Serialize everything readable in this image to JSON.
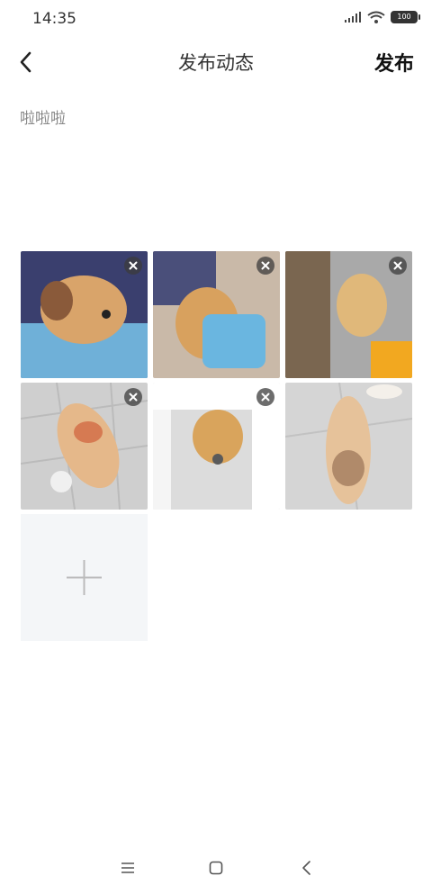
{
  "status": {
    "time": "14:35",
    "battery": "100"
  },
  "header": {
    "title": "发布动态",
    "publish_label": "发布"
  },
  "post": {
    "text": "啦啦啦"
  },
  "photos": [
    {
      "name": "dog-photo-1",
      "colors": [
        "#8a5a3a",
        "#d9a46a",
        "#6fb0d8",
        "#3a3f6e"
      ]
    },
    {
      "name": "dog-photo-2",
      "colors": [
        "#4a4f7a",
        "#d8a15e",
        "#6ab6e0",
        "#c9b9a8"
      ]
    },
    {
      "name": "dog-photo-3",
      "colors": [
        "#7a6650",
        "#e0b87a",
        "#f2a820",
        "#a9a9a9"
      ]
    },
    {
      "name": "dog-photo-4",
      "colors": [
        "#cfcfcf",
        "#e5b88a",
        "#d67a52",
        "#f0f0f0"
      ]
    },
    {
      "name": "dog-photo-5",
      "colors": [
        "#dcdcdc",
        "#d9a45c",
        "#5a5a5a",
        "#ffffff"
      ]
    },
    {
      "name": "dog-photo-6",
      "colors": [
        "#d5d5d5",
        "#e6c29a",
        "#b08a6a",
        "#f4f0ea"
      ]
    }
  ],
  "colors": {
    "add_tile_bg": "#f4f6f8",
    "plus_color": "#bbbbbb"
  }
}
